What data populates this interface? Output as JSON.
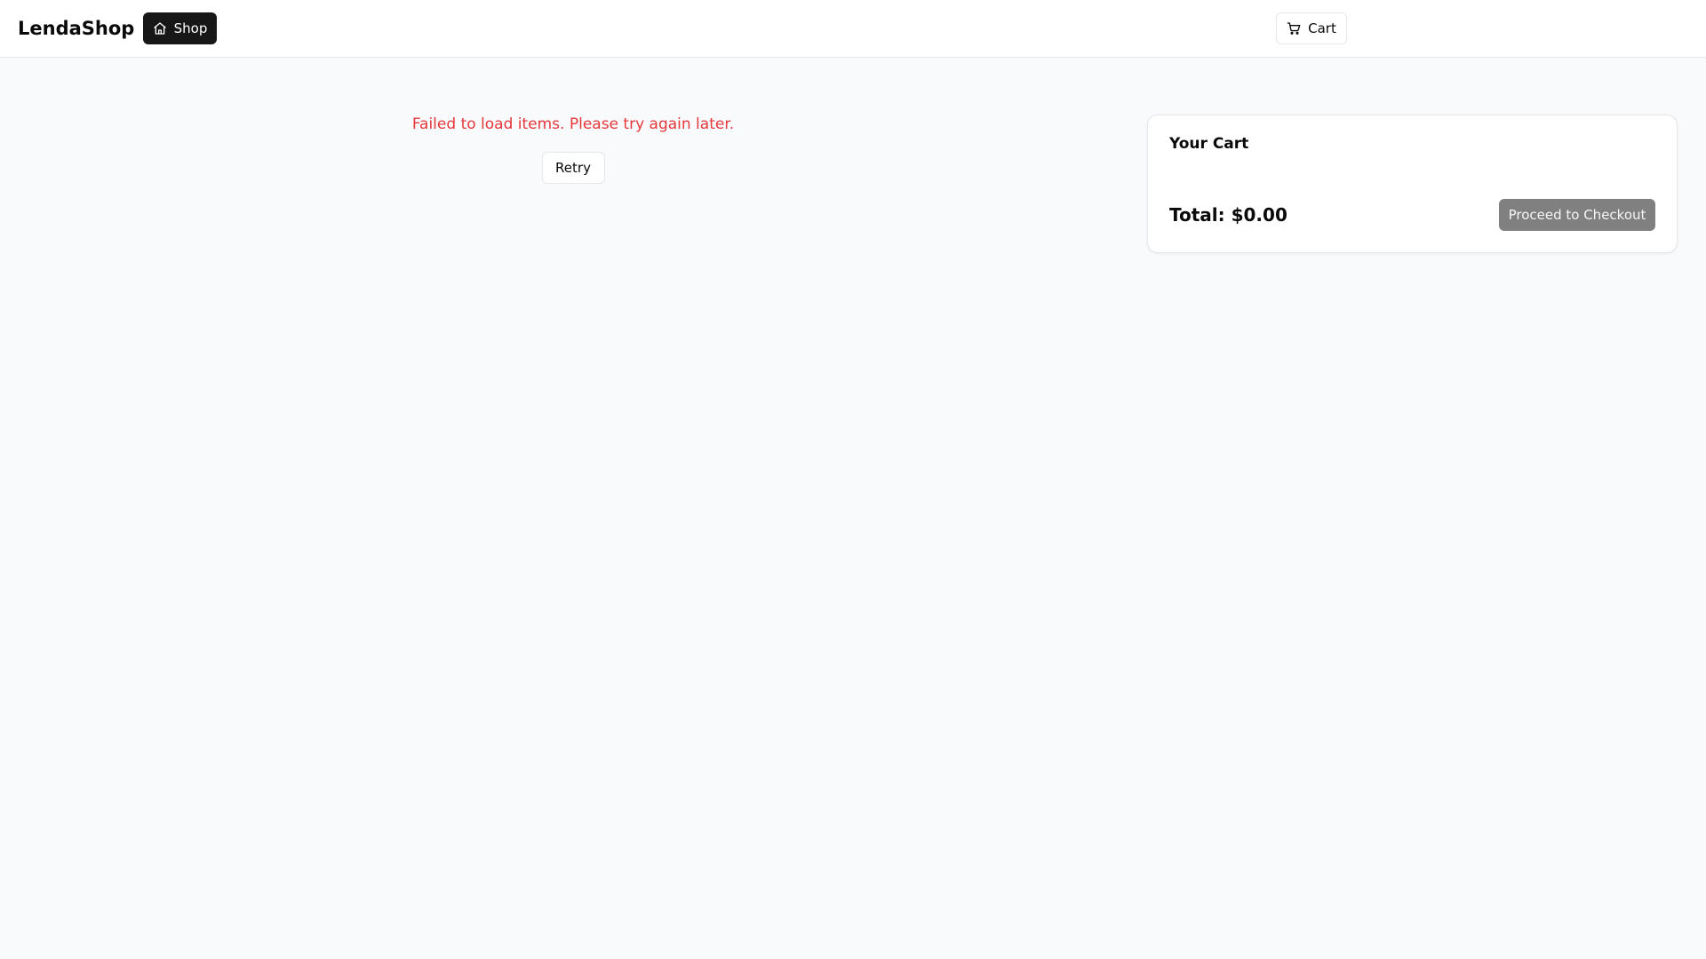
{
  "header": {
    "brand": "LendaShop",
    "shop_label": "Shop",
    "shop_icon": "home-icon",
    "cart_label": "Cart",
    "cart_icon": "cart-icon"
  },
  "main": {
    "error_message": "Failed to load items. Please try again later.",
    "retry_label": "Retry"
  },
  "cart": {
    "title": "Your Cart",
    "total": "Total: $0.00",
    "checkout_label": "Proceed to Checkout",
    "checkout_disabled": true
  },
  "colors": {
    "error": "#e5383b",
    "primary": "#171717",
    "disabled_button": "#808080",
    "background": "#f8fafc"
  }
}
